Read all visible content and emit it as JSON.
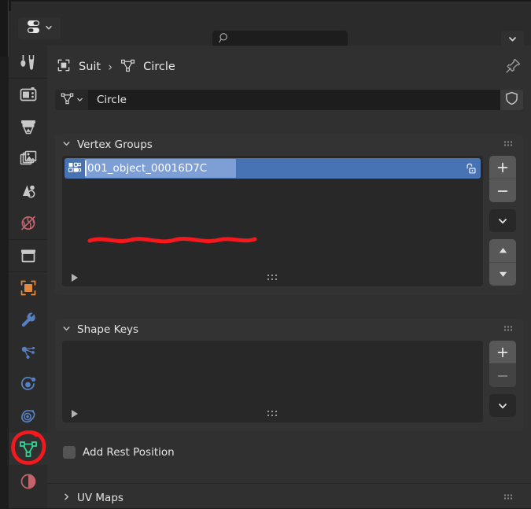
{
  "window": {
    "app": "Blender",
    "editor": "Properties"
  },
  "header": {
    "editor_type_icon": "properties-editor-icon",
    "editor_type_label": "Properties",
    "search": {
      "icon": "search-icon",
      "value": "",
      "placeholder": ""
    },
    "options_dropdown_icon": "chevron-down-icon"
  },
  "tabs": [
    {
      "key": "tool",
      "label": "Tool",
      "icon": "tool-icon",
      "color": "#c8c8c8",
      "active": false,
      "separator_above": false
    },
    {
      "key": "render",
      "label": "Render",
      "icon": "camera-back-icon",
      "color": "#c8c8c8",
      "active": false,
      "separator_above": true
    },
    {
      "key": "output",
      "label": "Output",
      "icon": "printer-icon",
      "color": "#c8c8c8",
      "active": false,
      "separator_above": false
    },
    {
      "key": "view_layer",
      "label": "View Layer",
      "icon": "images-icon",
      "color": "#c8c8c8",
      "active": false,
      "separator_above": false
    },
    {
      "key": "scene",
      "label": "Scene",
      "icon": "scene-cone-icon",
      "color": "#c8c8c8",
      "active": false,
      "separator_above": false
    },
    {
      "key": "world",
      "label": "World",
      "icon": "world-globe-icon",
      "color": "#c4636b",
      "active": false,
      "separator_above": false
    },
    {
      "key": "collection",
      "label": "Collection",
      "icon": "box-icon",
      "color": "#c8c8c8",
      "active": false,
      "separator_above": true
    },
    {
      "key": "object",
      "label": "Object",
      "icon": "object-square-icon",
      "color": "#e2893f",
      "active": false,
      "separator_above": true
    },
    {
      "key": "modifiers",
      "label": "Modifiers",
      "icon": "wrench-icon",
      "color": "#5680c2",
      "active": false,
      "separator_above": false
    },
    {
      "key": "particles",
      "label": "Particles",
      "icon": "particles-icon",
      "color": "#5680c2",
      "active": false,
      "separator_above": false
    },
    {
      "key": "physics",
      "label": "Physics",
      "icon": "physics-orbit-icon",
      "color": "#5680c2",
      "active": false,
      "separator_above": false
    },
    {
      "key": "constraints",
      "label": "Object Constraints",
      "icon": "constraint-icon",
      "color": "#5680c2",
      "active": false,
      "separator_above": false
    },
    {
      "key": "data",
      "label": "Object Data",
      "icon": "mesh-data-icon",
      "color": "#32d296",
      "active": true,
      "separator_above": false
    },
    {
      "key": "material",
      "label": "Material",
      "icon": "material-sphere-icon",
      "color": "#c4636b",
      "active": false,
      "separator_above": false
    }
  ],
  "annotation": {
    "color": "#f5181c",
    "circle_target": "mesh-data-tab",
    "underline_target": "vertex-group-name"
  },
  "breadcrumb": {
    "items": [
      {
        "label": "Suit",
        "icon": "object-square-icon"
      },
      {
        "label": "Circle",
        "icon": "mesh-data-icon"
      }
    ],
    "separator": "›",
    "pin_icon": "pin-icon"
  },
  "id_block": {
    "browse_icon": "mesh-data-icon",
    "browse_chevron": "chevron-down-icon",
    "name": "Circle",
    "fake_user_icon": "shield-icon"
  },
  "panels": {
    "vertex_groups": {
      "title": "Vertex Groups",
      "expanded": true,
      "collapse_icon": "chevron-down-icon",
      "grip_icon": "grip-dots-icon",
      "items": [
        {
          "name": "001_object_00016D7C",
          "icon": "group-vertex-icon",
          "selected": true,
          "editing": true,
          "lock_icon": "unlocked-icon",
          "locked": false
        }
      ],
      "side_buttons": [
        {
          "icon": "plus-icon",
          "name": "add-vertex-group-button",
          "label": "+"
        },
        {
          "icon": "minus-icon",
          "name": "remove-vertex-group-button",
          "label": "−"
        },
        {
          "icon": "chevron-down-icon",
          "name": "vertex-group-specials-button",
          "label": ""
        },
        {
          "icon": "triangle-up-icon",
          "name": "move-vertex-group-up-button",
          "label": ""
        },
        {
          "icon": "triangle-down-icon",
          "name": "move-vertex-group-down-button",
          "label": ""
        }
      ],
      "filter_icon": "filter-triangle-icon",
      "resize_grip_icon": "grip-dots-icon"
    },
    "shape_keys": {
      "title": "Shape Keys",
      "expanded": true,
      "collapse_icon": "chevron-down-icon",
      "grip_icon": "grip-dots-icon",
      "items": [],
      "side_buttons": [
        {
          "icon": "plus-icon",
          "name": "add-shape-key-button",
          "label": "+"
        },
        {
          "icon": "minus-icon",
          "name": "remove-shape-key-button",
          "label": "−"
        },
        {
          "icon": "chevron-down-icon",
          "name": "shape-key-specials-button",
          "label": ""
        }
      ],
      "filter_icon": "filter-triangle-icon",
      "resize_grip_icon": "grip-dots-icon",
      "checkbox": {
        "label": "Add Rest Position",
        "checked": false
      }
    },
    "uv_maps": {
      "title": "UV Maps",
      "expanded": false,
      "collapse_icon": "chevron-right-icon",
      "grip_icon": "grip-dots-icon"
    }
  }
}
